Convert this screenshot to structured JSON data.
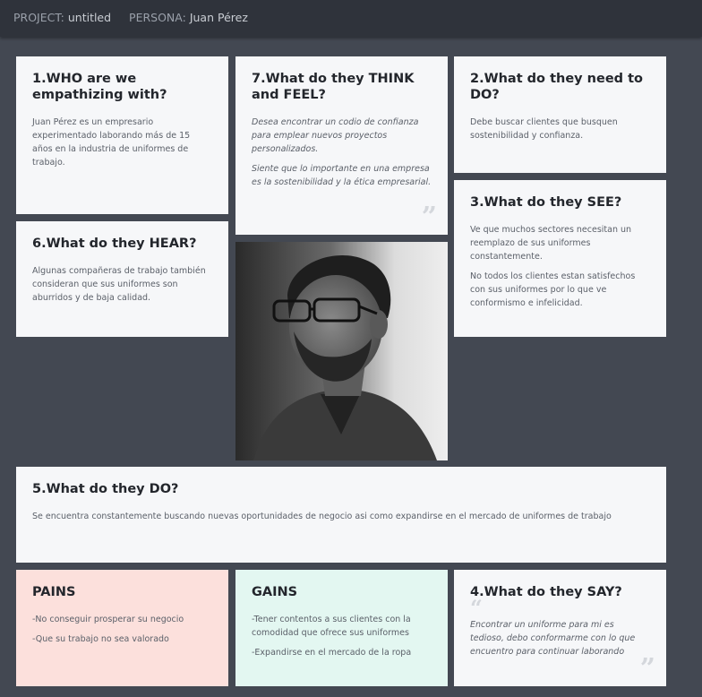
{
  "header": {
    "project_label": "PROJECT:",
    "project_value": "untitled",
    "persona_label": "PERSONA:",
    "persona_value": "Juan Pérez"
  },
  "cards": {
    "who": {
      "title": "1.WHO are we empathizing with?",
      "text": [
        "Juan Pérez es un empresario experimentado laborando más de 15 años en la industria de uniformes de trabajo."
      ]
    },
    "think": {
      "title": "7.What do they THINK and FEEL?",
      "text": [
        "Desea encontrar un codio de confianza para emplear nuevos proyectos personalizados.",
        "Siente que lo importante en una empresa es la sostenibilidad y la ética empresarial."
      ]
    },
    "need": {
      "title": "2.What do they need to DO?",
      "text": [
        "Debe buscar clientes que busquen sostenibilidad y confianza."
      ]
    },
    "see": {
      "title": "3.What do they SEE?",
      "text": [
        "Ve que muchos sectores necesitan un reemplazo de sus uniformes constantemente.",
        "No todos los clientes estan satisfechos con sus uniformes por lo que ve conformismo e infelicidad."
      ]
    },
    "hear": {
      "title": "6.What do they HEAR?",
      "text": [
        "Algunas compañeras de trabajo también consideran que sus uniformes son aburridos y de baja calidad."
      ]
    },
    "do": {
      "title": "5.What do they DO?",
      "text": [
        "Se encuentra constantemente buscando nuevas oportunidades de negocio asi como expandirse en el mercado de uniformes de trabajo"
      ]
    },
    "pains": {
      "title": "PAINS",
      "text": [
        "-No conseguir prosperar su negocio",
        "-Que su trabajo no sea valorado"
      ]
    },
    "gains": {
      "title": "GAINS",
      "text": [
        "-Tener contentos a sus clientes con la comodidad que ofrece sus uniformes",
        "-Expandirse en el mercado de la ropa"
      ]
    },
    "say": {
      "title": "4.What do they SAY?",
      "text": [
        "Encontrar un uniforme para mi es tedioso, debo conformarme con lo que encuentro para continuar laborando"
      ]
    }
  },
  "icons": {
    "quote_close": "”",
    "quote_open": "“"
  },
  "colors": {
    "background": "#434852",
    "topbar": "#2f333b",
    "card": "#f6f7f9",
    "pains": "#fce0dc",
    "gains": "#e3f7f1"
  }
}
